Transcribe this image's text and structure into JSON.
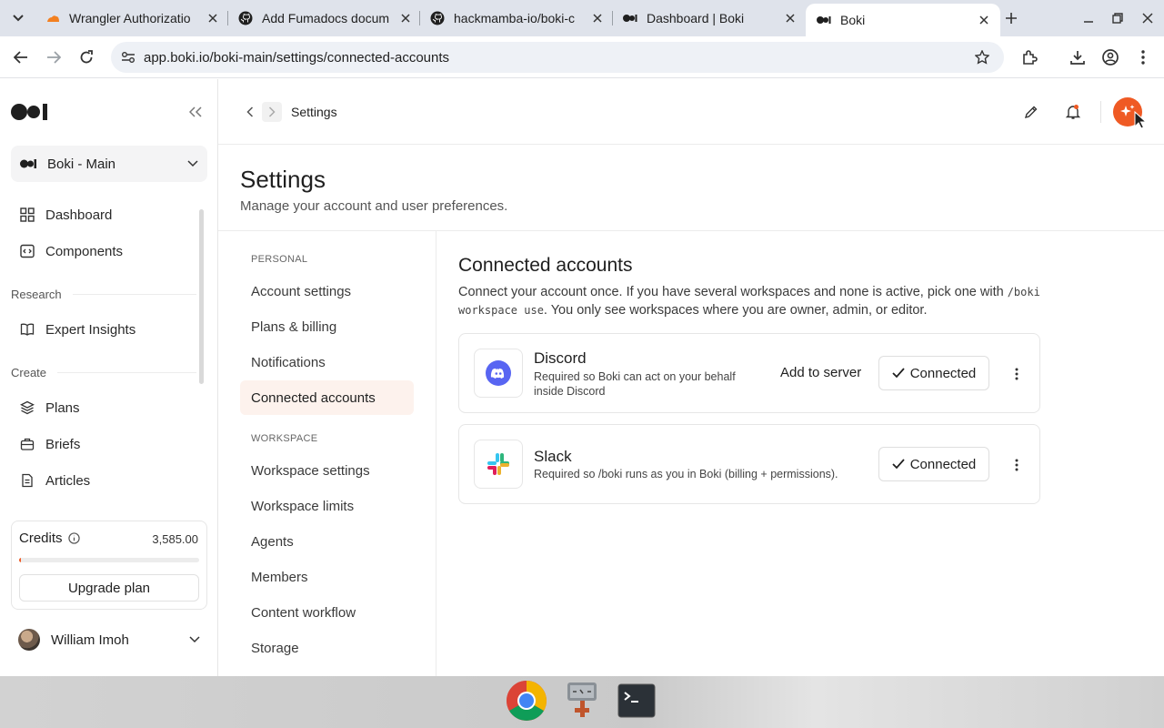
{
  "browser": {
    "tabs": [
      {
        "label": "Wrangler Authorizatio",
        "icon": "cloudflare-icon"
      },
      {
        "label": "Add Fumadocs docum",
        "icon": "github-icon"
      },
      {
        "label": "hackmamba-io/boki-c",
        "icon": "github-icon"
      },
      {
        "label": "Dashboard | Boki",
        "icon": "boki-icon"
      },
      {
        "label": "Boki",
        "icon": "boki-icon",
        "active": true
      }
    ],
    "url": "app.boki.io/boki-main/settings/connected-accounts"
  },
  "sidebar": {
    "workspace": "Boki - Main",
    "items_top": [
      {
        "label": "Dashboard",
        "icon": "grid-icon"
      },
      {
        "label": "Components",
        "icon": "code-icon"
      }
    ],
    "group_research": "Research",
    "items_research": [
      {
        "label": "Expert Insights",
        "icon": "book-icon"
      }
    ],
    "group_create": "Create",
    "items_create": [
      {
        "label": "Plans",
        "icon": "layers-icon"
      },
      {
        "label": "Briefs",
        "icon": "briefcase-icon"
      },
      {
        "label": "Articles",
        "icon": "document-icon"
      }
    ],
    "credits": {
      "label": "Credits",
      "value": "3,585.00",
      "usage_fraction": 0.01,
      "upgrade_label": "Upgrade plan"
    },
    "user": "William Imoh"
  },
  "header": {
    "breadcrumb": "Settings"
  },
  "page": {
    "title": "Settings",
    "subtitle": "Manage your account and user preferences."
  },
  "settings_nav": {
    "personal_group": "PERSONAL",
    "personal": [
      "Account settings",
      "Plans & billing",
      "Notifications",
      "Connected accounts"
    ],
    "active": "Connected accounts",
    "workspace_group": "WORKSPACE",
    "workspace": [
      "Workspace settings",
      "Workspace limits",
      "Agents",
      "Members",
      "Content workflow",
      "Storage"
    ]
  },
  "content": {
    "title": "Connected accounts",
    "desc_part1": "Connect your account once. If you have several workspaces and none is active, pick one with ",
    "desc_code": "/boki workspace use",
    "desc_part2": ". You only see workspaces where you are owner, admin, or editor.",
    "accounts": [
      {
        "name": "Discord",
        "description": "Required so Boki can act on your behalf inside Discord",
        "action": "Add to server",
        "status": "Connected"
      },
      {
        "name": "Slack",
        "description": "Required so /boki runs as you in Boki (billing + permissions).",
        "status": "Connected"
      }
    ]
  },
  "colors": {
    "accent": "#ef5a24",
    "active_nav_bg": "#fdf2ed",
    "discord": "#5865f2"
  }
}
